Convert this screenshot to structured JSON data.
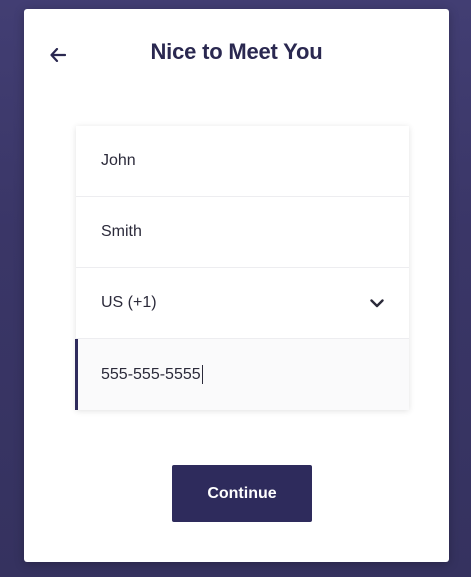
{
  "header": {
    "title": "Nice to Meet You",
    "back_icon": "arrow-left-icon"
  },
  "form": {
    "first_name": "John",
    "last_name": "Smith",
    "country_code": "US (+1)",
    "country_dropdown_icon": "chevron-down-icon",
    "phone": "555-555-5555"
  },
  "actions": {
    "continue_label": "Continue"
  },
  "colors": {
    "backdrop": "#3b3768",
    "primary": "#2e2b5c",
    "title_text": "#2a2850",
    "surface": "#ffffff"
  }
}
